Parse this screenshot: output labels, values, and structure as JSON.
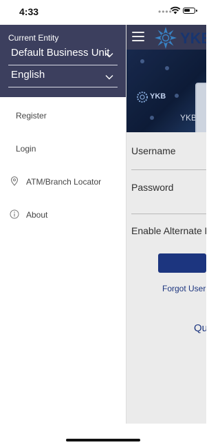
{
  "status_bar": {
    "time": "4:33",
    "signal_dots": "••••"
  },
  "drawer": {
    "entity_label": "Current Entity",
    "entity_value": "Default Business Unit",
    "language_value": "English",
    "items": [
      {
        "label": "Register",
        "icon": ""
      },
      {
        "label": "Login",
        "icon": ""
      },
      {
        "label": "ATM/Branch Locator",
        "icon": "location-pin-icon"
      },
      {
        "label": "About",
        "icon": "info-icon"
      }
    ]
  },
  "background_app": {
    "brand": "YKB",
    "banner_brand": "YKB",
    "banner_caption": "YKB In",
    "username_label": "Username",
    "password_label": "Password",
    "alternate_label": "Enable Alternate L",
    "forgot_link": "Forgot User I",
    "quick_link": "Qu"
  },
  "colors": {
    "drawer_header": "#3c3f5e",
    "accent_blue": "#1f3a8a",
    "text_gray": "#444444"
  }
}
